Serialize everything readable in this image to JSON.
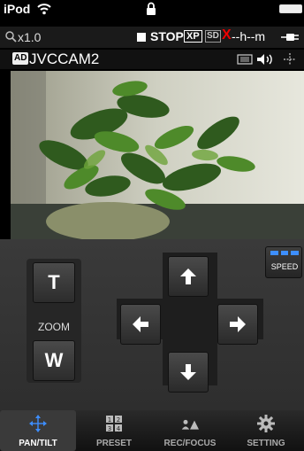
{
  "status_bar": {
    "device": "iPod"
  },
  "info_bar": {
    "zoom": "x1.0",
    "record_state": "STOP",
    "mode_badge": "XP",
    "media_badge": "SD",
    "media_error": "X",
    "record_time": "--h--m"
  },
  "camera": {
    "ad_badge": "AD",
    "name": "JVCCAM2"
  },
  "controls": {
    "zoom_tele": "T",
    "zoom_label": "ZOOM",
    "zoom_wide": "W",
    "speed_label": "SPEED",
    "speed_level": 3
  },
  "tabs": [
    {
      "label": "PAN/TILT",
      "icon": "pan-tilt-icon",
      "active": true
    },
    {
      "label": "PRESET",
      "icon": "preset-grid-icon",
      "active": false
    },
    {
      "label": "REC/FOCUS",
      "icon": "rec-focus-icon",
      "active": false
    },
    {
      "label": "SETTING",
      "icon": "gear-icon",
      "active": false
    }
  ],
  "colors": {
    "accent": "#3d8eff",
    "error": "#e00000"
  }
}
